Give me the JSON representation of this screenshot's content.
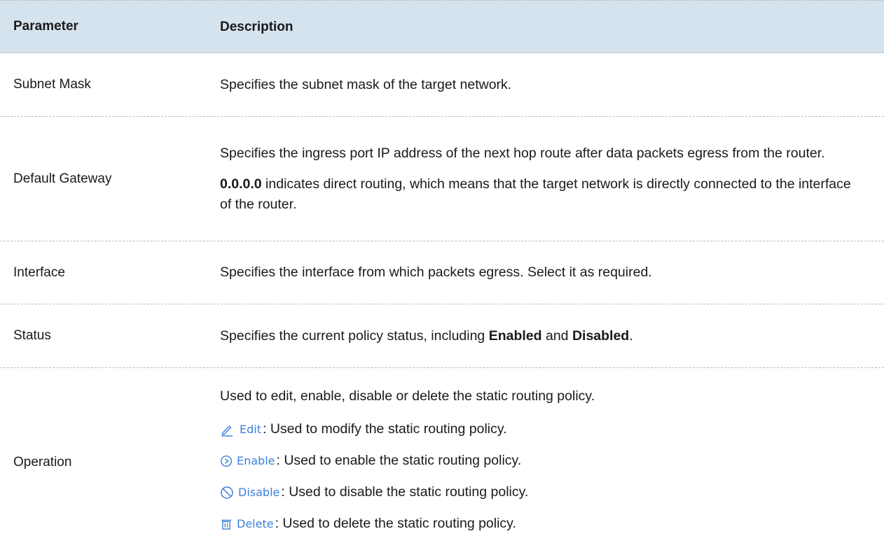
{
  "header": {
    "param": "Parameter",
    "desc": "Description"
  },
  "rows": {
    "subnet": {
      "name": "Subnet Mask",
      "desc": "Specifies the subnet mask of the target network."
    },
    "gateway": {
      "name": "Default Gateway",
      "desc1": "Specifies the ingress port IP address of the next hop route after data packets egress from the router.",
      "desc2_bold": "0.0.0.0",
      "desc2_rest": " indicates direct routing, which means that the target network is directly connected to the interface of the router."
    },
    "interface": {
      "name": "Interface",
      "desc": "Specifies the interface from which packets egress. Select it as required."
    },
    "status": {
      "name": "Status",
      "pre": "Specifies the current policy status, including ",
      "enabled": "Enabled",
      "and": " and ",
      "disabled": "Disabled",
      "end": "."
    },
    "operation": {
      "name": "Operation",
      "intro": "Used to edit, enable, disable or delete the static routing policy.",
      "edit_label": "Edit",
      "edit_desc": ": Used to modify the static routing policy.",
      "enable_label": "Enable",
      "enable_desc": ": Used to enable the static routing policy.",
      "disable_label": "Disable",
      "disable_desc": " : Used to disable the static routing policy.",
      "delete_label": "Delete",
      "delete_desc": " : Used to delete the static routing policy."
    }
  },
  "colors": {
    "header_bg": "#d5e3ee",
    "icon_blue": "#3c7fdc",
    "divider": "#b9b9b9"
  }
}
